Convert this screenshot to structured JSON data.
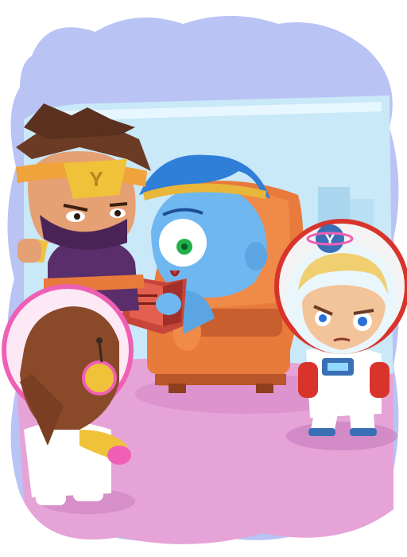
{
  "scene": {
    "palette": {
      "cloud_sky": "#b9c3f4",
      "room_wall": "#c9e8f8",
      "window_glow": "#eaf8ff",
      "floor": "#e6a3d7",
      "floor_shade": "#d98ccb",
      "armchair": "#e87a3c",
      "armchair_dark": "#b9562a",
      "book": "#c8453b",
      "reader_skin": "#6fb7f1",
      "reader_hair": "#2f7ed8",
      "ninja_band": "#f0c23a",
      "ninja_outfit": "#5a2e6a",
      "astronaut_suit": "#ffffff",
      "astronaut_accent": "#d9342b",
      "girl_suit_accent": "#ef5fb4"
    },
    "characters": [
      {
        "name": "ninja",
        "headband_letter": "Y"
      },
      {
        "name": "blue-reader",
        "headband_letter": ""
      },
      {
        "name": "astronaut-boy",
        "helmet_letter": "Y"
      },
      {
        "name": "astronaut-girl",
        "helmet_letter": ""
      }
    ]
  }
}
